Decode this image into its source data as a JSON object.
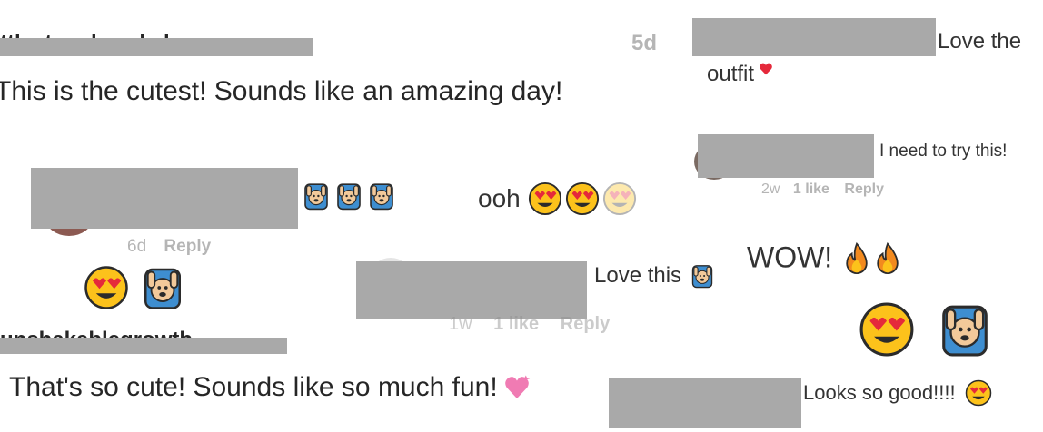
{
  "comments": {
    "c1": {
      "username_partial": "ttlestonebrookshop",
      "time": "5d",
      "text": "This is the cutest! Sounds like an amazing day!"
    },
    "c2": {
      "text": "Love the",
      "text_cont": "outfit"
    },
    "c3": {
      "text": "I need to try this!",
      "time": "2w",
      "likes": "1 like",
      "reply": "Reply"
    },
    "c4": {
      "time": "6d",
      "reply": "Reply"
    },
    "c5": {
      "text": "ooh"
    },
    "c6": {
      "text": "Love this",
      "time": "1w",
      "likes": "1 like",
      "reply": "Reply"
    },
    "c7": {
      "text": "WOW!"
    },
    "c8": {
      "username_partial": "unshakablegrowth",
      "text": "That's so cute! Sounds like so much fun!"
    },
    "c9": {
      "text": "Looks so good!!!!"
    }
  },
  "icons": {
    "raised_hands": "raised-hands-emoji",
    "heart_eyes": "heart-eyes-emoji",
    "fire": "fire-emoji",
    "red_heart": "red-heart-emoji",
    "pink_heart": "sparkling-heart-emoji"
  },
  "colors": {
    "redaction": "#a9a9a9",
    "text": "#262626",
    "meta": "#8e8e8e"
  }
}
